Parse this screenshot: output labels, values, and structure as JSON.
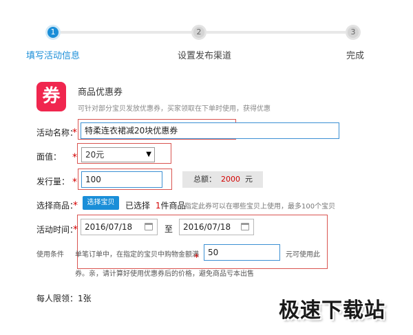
{
  "steps": [
    {
      "num": "1",
      "label": "填写活动信息"
    },
    {
      "num": "2",
      "label": "设置发布渠道"
    },
    {
      "num": "3",
      "label": "完成"
    }
  ],
  "coupon": {
    "icon_char": "券",
    "title": "商品优惠券",
    "desc": "可针对部分宝贝发放优惠券，买家领取在下单时使用，获得优惠"
  },
  "form": {
    "activity_name_label": "活动名称：",
    "activity_name_value": "特柔连衣裙减20块优惠券",
    "face_value_label": "面值：",
    "face_value_selected": "20元",
    "issue_qty_label": "发行量：",
    "issue_qty_value": "100",
    "total_label": "总额：",
    "total_value": "2000",
    "total_unit": "元",
    "select_goods_label": "选择商品：",
    "select_goods_button": "选择宝贝",
    "selected_prefix": "已选择",
    "selected_count": "1",
    "selected_suffix": "件商品",
    "selected_hint": "指定此券可以在哪些宝贝上使用，最多100个宝贝",
    "activity_time_label": "活动时间：",
    "start_date": "2016/07/18",
    "to_label": "至",
    "end_date": "2016/07/18",
    "usage_label": "使用条件",
    "usage_text1": "单笔订单中，在指定的宝贝中购物金额满",
    "usage_amount": "50",
    "usage_text2": "元可使用此",
    "usage_text3": "券。亲，请计算好使用优惠券后的价格，避免商品亏本出售",
    "per_person_label": "每人限领：",
    "per_person_value": "1张",
    "required_mark": "*"
  },
  "watermark": "极速下载站",
  "colors": {
    "accent": "#1a8ed8",
    "coupon_red": "#f0264e",
    "required_red": "#d40000"
  }
}
